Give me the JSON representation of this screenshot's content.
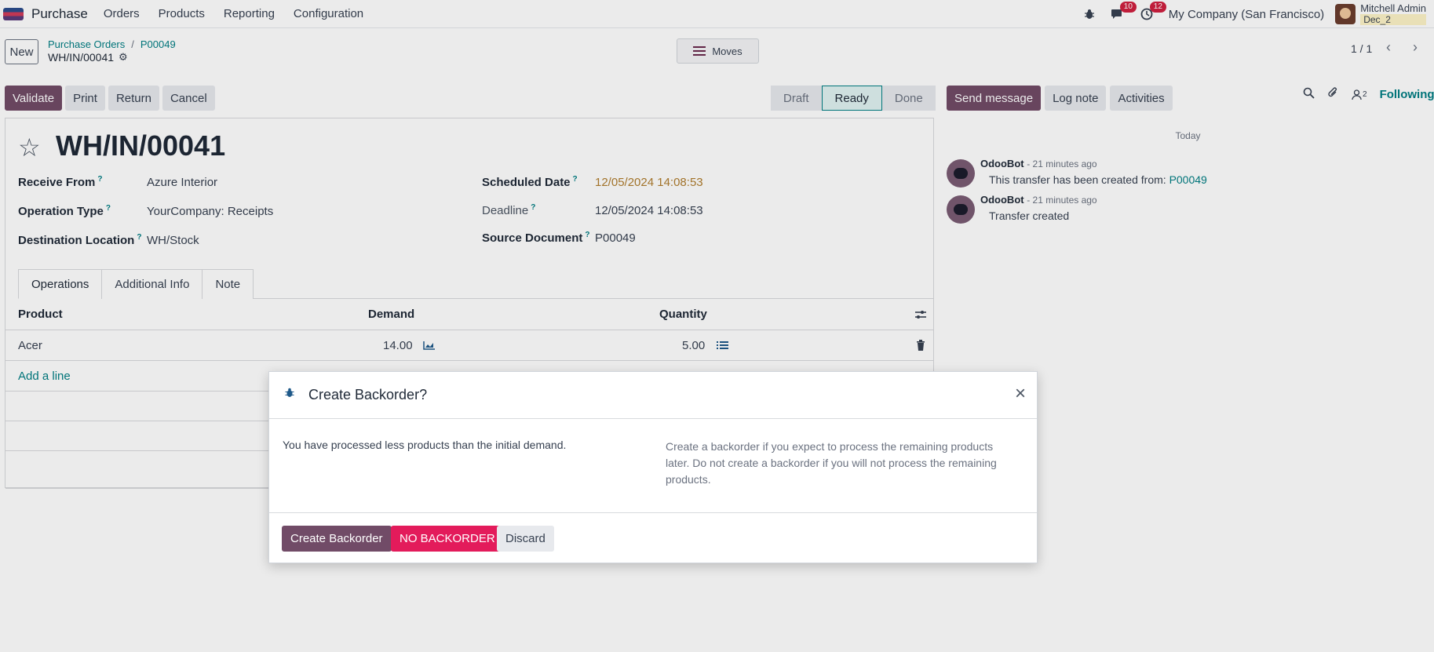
{
  "navbar": {
    "app_name": "Purchase",
    "menu": [
      "Orders",
      "Products",
      "Reporting",
      "Configuration"
    ],
    "messages_count": "10",
    "activities_count": "12",
    "company": "My Company (San Francisco)",
    "user_name": "Mitchell Admin",
    "database": "Dec_2"
  },
  "control": {
    "new_label": "New",
    "breadcrumb_root": "Purchase Orders",
    "breadcrumb_parent": "P00049",
    "record_name": "WH/IN/00041",
    "moves_label": "Moves",
    "pager": "1 / 1"
  },
  "actions": {
    "validate": "Validate",
    "print": "Print",
    "return": "Return",
    "cancel": "Cancel"
  },
  "stages": [
    "Draft",
    "Ready",
    "Done"
  ],
  "form": {
    "title": "WH/IN/00041",
    "receive_from_label": "Receive From",
    "receive_from": "Azure Interior",
    "operation_type_label": "Operation Type",
    "operation_type": "YourCompany: Receipts",
    "destination_label": "Destination Location",
    "destination": "WH/Stock",
    "scheduled_date_label": "Scheduled Date",
    "scheduled_date": "12/05/2024 14:08:53",
    "deadline_label": "Deadline",
    "deadline": "12/05/2024 14:08:53",
    "source_doc_label": "Source Document",
    "source_doc": "P00049",
    "help_mark": "?"
  },
  "tabs": [
    "Operations",
    "Additional Info",
    "Note"
  ],
  "table": {
    "headers": {
      "product": "Product",
      "demand": "Demand",
      "quantity": "Quantity"
    },
    "rows": [
      {
        "product": "Acer",
        "demand": "14.00",
        "quantity": "5.00"
      }
    ],
    "add_line": "Add a line"
  },
  "chatter": {
    "send_message": "Send message",
    "log_note": "Log note",
    "activities": "Activities",
    "followers_count": "2",
    "following": "Following",
    "today": "Today",
    "messages": [
      {
        "author": "OdooBot",
        "time": "- 21 minutes ago",
        "body": "This transfer has been created from:",
        "link": "P00049"
      },
      {
        "author": "OdooBot",
        "time": "- 21 minutes ago",
        "body": "Transfer created",
        "link": ""
      }
    ]
  },
  "modal": {
    "title": "Create Backorder?",
    "left_text": "You have processed less products than the initial demand.",
    "right_text": "Create a backorder if you expect to process the remaining products later. Do not create a backorder if you will not process the remaining products.",
    "create_backorder": "Create Backorder",
    "no_backorder": "NO BACKORDER",
    "discard": "Discard"
  },
  "colors": {
    "primary": "#714b67",
    "accent": "#017e84",
    "danger": "#e31b5b",
    "badge": "#d0203f"
  }
}
